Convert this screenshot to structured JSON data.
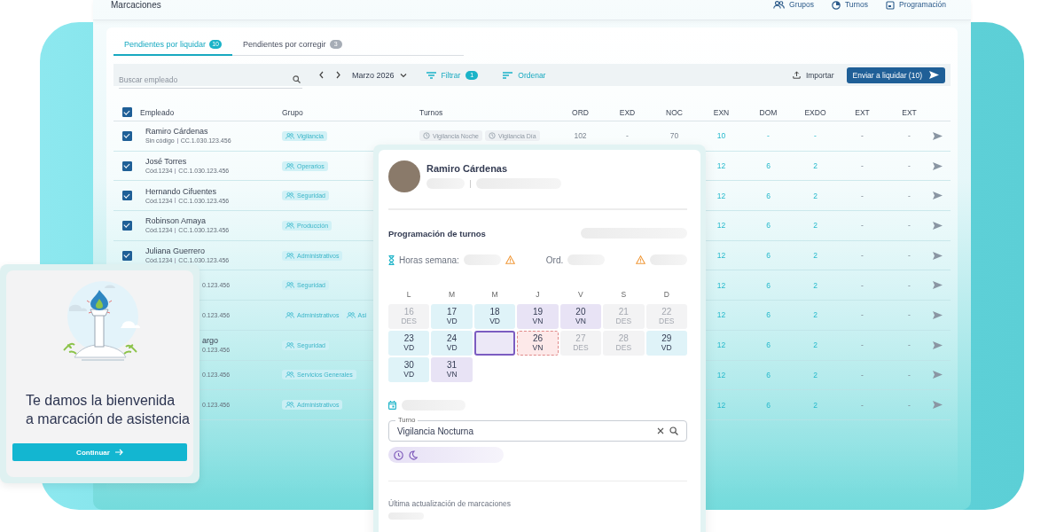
{
  "header": {
    "title": "Marcaciones",
    "nav": [
      {
        "label": "Grupos"
      },
      {
        "label": "Turnos"
      },
      {
        "label": "Programación"
      }
    ]
  },
  "tabs": [
    {
      "label": "Pendientes por liquidar",
      "count": "10",
      "selected": true
    },
    {
      "label": "Pendientes por corregir",
      "count": "3",
      "selected": false
    }
  ],
  "toolbar": {
    "search": {
      "placeholder": "Buscar empleado"
    },
    "month": "Marzo 2026",
    "filter": {
      "label": "Filtrar",
      "count": "1"
    },
    "sort": "Ordenar",
    "import": "Importar",
    "submit": "Enviar a liquidar (10)"
  },
  "table": {
    "all_checked": true,
    "columns": [
      "Empleado",
      "Grupo",
      "Turnos"
    ],
    "value_columns": [
      {
        "label": "ORD",
        "accent": false
      },
      {
        "label": "EXD",
        "accent": false
      },
      {
        "label": "NOC",
        "accent": false
      },
      {
        "label": "EXN",
        "accent": true
      },
      {
        "label": "DOM",
        "accent": true
      },
      {
        "label": "EXDO",
        "accent": true
      },
      {
        "label": "EXT",
        "accent": false
      },
      {
        "label": "EXT",
        "accent": false
      }
    ],
    "rows": [
      {
        "kind": "full",
        "checked": true,
        "name": "Ramiro Cárdenas",
        "code": "Sin código",
        "cc": "CC.1.030.123.456",
        "groups": [
          "Vigilancia"
        ],
        "shifts": [
          "Vigilancia Noche",
          "Vigilancia Día"
        ],
        "values": [
          "102",
          "-",
          "70",
          "10",
          "-",
          "-",
          "-",
          "-"
        ]
      },
      {
        "kind": "full",
        "checked": true,
        "name": "José Torres",
        "code": "Cód.1234",
        "cc": "CC.1.030.123.456",
        "groups": [
          "Operarios"
        ],
        "values": [
          "12",
          "6",
          "2",
          "-",
          "-"
        ]
      },
      {
        "kind": "full",
        "checked": true,
        "name": "Hernando Cifuentes",
        "code": "Cód.1234",
        "cc": "CC.1.030.123.456",
        "groups": [
          "Seguridad"
        ],
        "values": [
          "12",
          "6",
          "2",
          "-",
          "-"
        ]
      },
      {
        "kind": "full",
        "checked": true,
        "name": "Robinson Amaya",
        "code": "Cód.1234",
        "cc": "CC.1.030.123.456",
        "groups": [
          "Producción"
        ],
        "values": [
          "12",
          "6",
          "2",
          "-",
          "-"
        ]
      },
      {
        "kind": "full",
        "checked": true,
        "name": "Juliana Guerrero",
        "code": "Cód.1234",
        "cc": "CC.1.030.123.456",
        "groups": [
          "Administrativos"
        ],
        "values": [
          "12",
          "6",
          "2",
          "-",
          "-"
        ]
      },
      {
        "kind": "partial",
        "cc": "0.123.456",
        "groups": [
          "Seguridad"
        ],
        "values": [
          "12",
          "6",
          "2",
          "-",
          "-"
        ]
      },
      {
        "kind": "partial",
        "cc": "0.123.456",
        "groups": [
          "Administrativos",
          "Asi"
        ],
        "values": [
          "12",
          "6",
          "2",
          "-",
          "-"
        ]
      },
      {
        "kind": "partial",
        "name": "argo",
        "cc": "0.123.456",
        "groups": [
          "Seguridad"
        ],
        "values": [
          "12",
          "6",
          "2",
          "-",
          "-"
        ]
      },
      {
        "kind": "partial",
        "cc": "0.123.456",
        "groups": [
          "Servicios Generales"
        ],
        "values": [
          "12",
          "6",
          "2",
          "-",
          "-"
        ]
      },
      {
        "kind": "partial",
        "cc": "0.123.456",
        "groups": [
          "Administrativos"
        ],
        "values": [
          "12",
          "6",
          "2",
          "-",
          "-"
        ]
      }
    ]
  },
  "profile_panel": {
    "name": "Ramiro Cárdenas",
    "section_title": "Programación de turnos",
    "hours_label": "Horas semana:",
    "ord_label": "Ord.",
    "weekdays": [
      "L",
      "M",
      "M",
      "J",
      "V",
      "S",
      "D"
    ],
    "days": [
      {
        "day": "16",
        "code": "DES",
        "kind": "rest",
        "selected": false
      },
      {
        "day": "17",
        "code": "VD",
        "kind": "day",
        "selected": false
      },
      {
        "day": "18",
        "code": "VD",
        "kind": "day",
        "selected": false
      },
      {
        "day": "19",
        "code": "VN",
        "kind": "night",
        "selected": false
      },
      {
        "day": "20",
        "code": "VN",
        "kind": "night",
        "selected": false
      },
      {
        "day": "21",
        "code": "DES",
        "kind": "rest",
        "selected": false
      },
      {
        "day": "22",
        "code": "DES",
        "kind": "rest",
        "selected": false
      },
      {
        "day": "23",
        "code": "VD",
        "kind": "day",
        "selected": false
      },
      {
        "day": "24",
        "code": "VD",
        "kind": "day",
        "selected": false
      },
      {
        "kind": "blank",
        "selected": true
      },
      {
        "day": "26",
        "code": "VN",
        "kind": "conflict",
        "selected": false
      },
      {
        "day": "27",
        "code": "DES",
        "kind": "rest",
        "selected": false
      },
      {
        "day": "28",
        "code": "DES",
        "kind": "rest",
        "selected": false
      },
      {
        "day": "29",
        "code": "VD",
        "kind": "day",
        "selected": false
      },
      {
        "day": "30",
        "code": "VD",
        "kind": "day",
        "selected": false
      },
      {
        "day": "31",
        "code": "VN",
        "kind": "night",
        "selected": false
      }
    ],
    "shift_field": {
      "label": "Turno",
      "value": "Vigilancia Nocturna"
    },
    "last_update_label": "Última actualización de marcaciones"
  },
  "welcome": {
    "title_lines": [
      "Te damos la bienvenida",
      "a marcación de asistencia"
    ],
    "button": "Continuar"
  }
}
